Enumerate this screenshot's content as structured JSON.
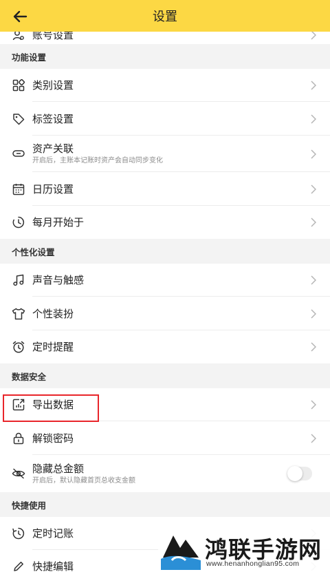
{
  "header": {
    "title": "设置"
  },
  "rows": {
    "account": {
      "label": "账号设置"
    },
    "category": {
      "label": "类别设置"
    },
    "tag": {
      "label": "标签设置"
    },
    "asset": {
      "label": "资产关联",
      "sub": "开启后，主账本记账时资产会自动同步变化"
    },
    "calendar": {
      "label": "日历设置"
    },
    "month_start": {
      "label": "每月开始于"
    },
    "sound": {
      "label": "声音与触感"
    },
    "theme": {
      "label": "个性装扮"
    },
    "reminder": {
      "label": "定时提醒"
    },
    "export": {
      "label": "导出数据"
    },
    "unlock": {
      "label": "解锁密码"
    },
    "hide_total": {
      "label": "隐藏总金额",
      "sub": "开启后，默认隐藏首页总收支金额",
      "toggle_on": false
    },
    "timed_record": {
      "label": "定时记账"
    },
    "quick_edit": {
      "label": "快捷编辑"
    }
  },
  "sections": {
    "function": "功能设置",
    "personal": "个性化设置",
    "data_security": "数据安全",
    "shortcuts": "快捷使用"
  },
  "watermark": {
    "name": "鸿联手游网",
    "site": "www.henanhonglian95.com"
  },
  "colors": {
    "header": "#fcd844",
    "highlight": "#e8252a",
    "background": "#f3f3f3"
  }
}
